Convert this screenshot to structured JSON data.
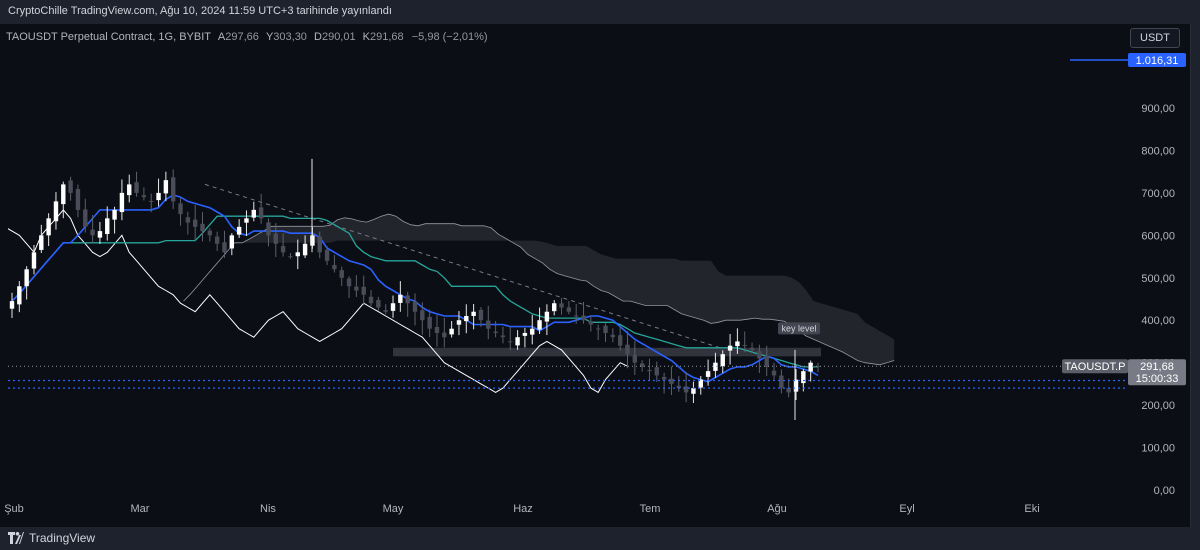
{
  "header": {
    "published": "CryptoChille TradingView.com, Ağu 10, 2024 11:59 UTC+3 tarihinde yayınlandı"
  },
  "legend": {
    "symbol": "TAOUSDT Perpetual Contract, 1G, BYBIT",
    "open_key": "A",
    "open": "297,66",
    "high_key": "Y",
    "high": "303,30",
    "low_key": "D",
    "low": "290,01",
    "close_key": "K",
    "close": "291,68",
    "change": "−5,98 (−2,01%)"
  },
  "price_scale": {
    "currency": "USDT",
    "ticks": [
      "900,00",
      "800,00",
      "700,00",
      "600,00",
      "500,00",
      "400,00",
      "300,00",
      "200,00",
      "100,00",
      "0,00"
    ],
    "alert_price": "1.016,31",
    "symbol_tag": "TAOUSDT.P",
    "last_price": "291,68",
    "countdown": "15:00:33"
  },
  "time_scale": {
    "ticks": [
      "Şub",
      "Mar",
      "Nis",
      "May",
      "Haz",
      "Tem",
      "Ağu",
      "Eyl",
      "Eki"
    ]
  },
  "annotations": {
    "key_level": "key level"
  },
  "footer": {
    "brand": "TradingView"
  },
  "colors": {
    "background": "#0c0e15",
    "tenkan": "#2962ff",
    "kijun": "#26a69a",
    "chikou": "#ffffff",
    "cloud": "#787b86",
    "alert_line": "#2962ff"
  },
  "chart_data": {
    "type": "candlestick",
    "indicator": "Ichimoku Cloud",
    "ylim": [
      0,
      1050
    ],
    "x_ticks": [
      "Şub",
      "Mar",
      "Nis",
      "May",
      "Haz",
      "Tem",
      "Ağu",
      "Eyl",
      "Eki"
    ],
    "key_level_zone": [
      315,
      335
    ],
    "alert_level": 1016.31,
    "last_price": 291.68,
    "dotted_levels": [
      291.68,
      258,
      240
    ],
    "close_series": [
      445,
      480,
      520,
      560,
      600,
      640,
      680,
      720,
      700,
      660,
      620,
      600,
      610,
      640,
      660,
      700,
      720,
      700,
      690,
      680,
      700,
      730,
      680,
      650,
      630,
      620,
      610,
      600,
      580,
      560,
      600,
      620,
      640,
      660,
      640,
      600,
      580,
      560,
      550,
      560,
      580,
      600,
      560,
      540,
      520,
      500,
      480,
      470,
      460,
      440,
      430,
      420,
      440,
      460,
      440,
      420,
      400,
      380,
      370,
      360,
      380,
      400,
      410,
      420,
      400,
      380,
      370,
      360,
      350,
      360,
      370,
      380,
      400,
      420,
      440,
      430,
      420,
      410,
      400,
      390,
      380,
      370,
      360,
      340,
      320,
      300,
      290,
      280,
      270,
      260,
      250,
      240,
      230,
      240,
      260,
      280,
      300,
      320,
      340,
      350,
      340,
      330,
      310,
      290,
      270,
      240,
      230,
      260,
      280,
      300,
      291.68
    ]
  }
}
